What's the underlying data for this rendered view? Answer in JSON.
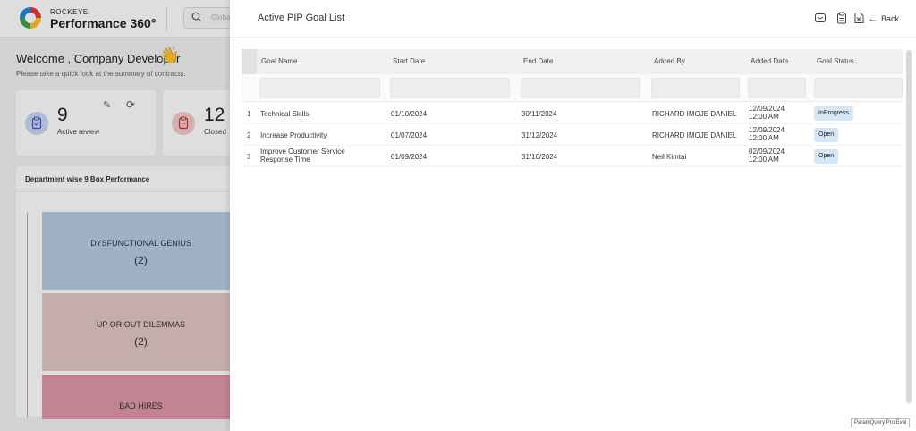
{
  "header": {
    "brand_top": "ROCKEYE",
    "brand_main": "Performance 360°",
    "search_placeholder": "Global"
  },
  "dashboard": {
    "welcome": "Welcome , Company Developer",
    "subtitle": "Please take a quick look at the summary of contracts.",
    "cards": [
      {
        "value": "9",
        "label": "Active review"
      },
      {
        "value": "12",
        "label": "Closed"
      }
    ],
    "dept_panel_title": "Department wise 9 Box Performance",
    "boxes": [
      {
        "name": "DYSFUNCTIONAL GENIUS",
        "count": "(2)",
        "color": "#b7cde3"
      },
      {
        "name": "UP OR OUT DILEMMAS",
        "count": "(2)",
        "color": "#e3c7c3"
      },
      {
        "name": "BAD HIRES",
        "count": "",
        "color": "#df97a8"
      }
    ]
  },
  "drawer": {
    "title": "Active PIP Goal List",
    "back_label": "Back",
    "columns": [
      "Goal Name",
      "Start Date",
      "End Date",
      "Added By",
      "Added Date",
      "Goal Status"
    ],
    "rows": [
      {
        "num": "1",
        "goal": "Technical Skills",
        "start": "01/10/2024",
        "end": "30/11/2024",
        "added_by": "RICHARD IMOJE DANIEL",
        "added_date": "12/09/2024",
        "added_time": "12:00 AM",
        "status": "InProgress"
      },
      {
        "num": "2",
        "goal": "Increase Productivity",
        "start": "01/07/2024",
        "end": "31/12/2024",
        "added_by": "RICHARD IMOJE DANIEL",
        "added_date": "12/09/2024",
        "added_time": "12:00 AM",
        "status": "Open"
      },
      {
        "num": "3",
        "goal": "Improve Customer Service Response Time",
        "goal_line1": "Improve Customer Service",
        "goal_line2": "Response Time",
        "start": "01/09/2024",
        "end": "31/10/2024",
        "added_by": "Neil Kimtai",
        "added_date": "02/09/2024",
        "added_time": "12:00 AM",
        "status": "Open"
      }
    ],
    "watermark": "ParamQuery Pro Eval"
  },
  "colors": {
    "status_badge": "#d5e6f7",
    "accent": "#1e88e5"
  }
}
